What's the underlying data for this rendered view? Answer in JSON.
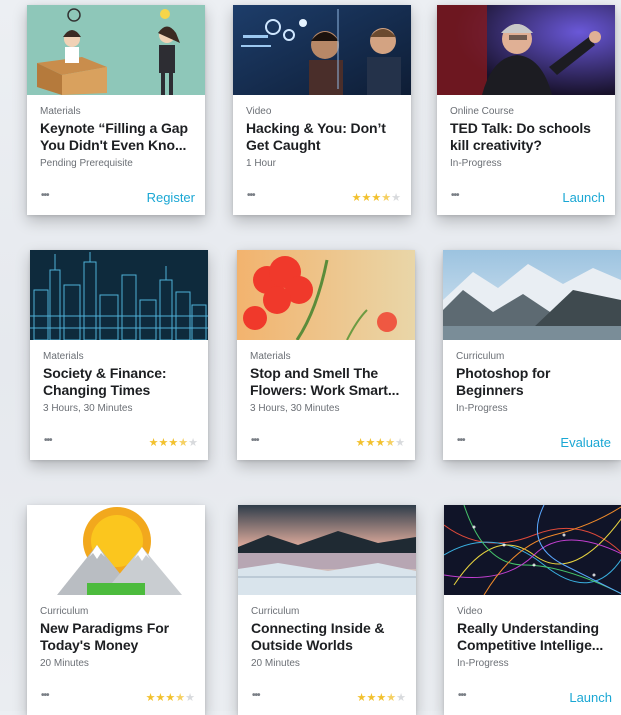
{
  "cards": [
    {
      "type": "Materials",
      "title": "Keynote “Filling a Gap You Didn't Even Kno...",
      "meta": "Pending Prerequisite",
      "action": "Register",
      "rating": null,
      "thumbnail": "cartoon-box-people"
    },
    {
      "type": "Video",
      "title": "Hacking & You: Don’t Get Caught",
      "meta": "1 Hour",
      "action": null,
      "rating": 3.5,
      "thumbnail": "hackers-screen"
    },
    {
      "type": "Online Course",
      "title": "TED Talk: Do schools kill creativity?",
      "meta": "In-Progress",
      "action": "Launch",
      "rating": null,
      "thumbnail": "speaker-stage"
    },
    {
      "type": "Materials",
      "title": "Society & Finance: Changing Times",
      "meta": "3 Hours, 30 Minutes",
      "action": null,
      "rating": 3.5,
      "thumbnail": "city-skyline"
    },
    {
      "type": "Materials",
      "title": "Stop and Smell The Flowers: Work Smart...",
      "meta": "3 Hours, 30 Minutes",
      "action": null,
      "rating": 3.5,
      "thumbnail": "red-flowers"
    },
    {
      "type": "Curriculum",
      "title": "Photoshop for Beginners",
      "meta": "In-Progress",
      "action": "Evaluate",
      "rating": null,
      "thumbnail": "mountain-lake"
    },
    {
      "type": "Curriculum",
      "title": "New Paradigms For Today's Money",
      "meta": "20 Minutes",
      "action": null,
      "rating": 3.5,
      "thumbnail": "sun-mountains"
    },
    {
      "type": "Curriculum",
      "title": "Connecting Inside & Outside Worlds",
      "meta": "20 Minutes",
      "action": null,
      "rating": 3.5,
      "thumbnail": "lake-reflection"
    },
    {
      "type": "Video",
      "title": "Really Understanding Competitive Intellige...",
      "meta": "In-Progress",
      "action": "Launch",
      "rating": null,
      "thumbnail": "neural-network"
    }
  ],
  "more_label": "•••",
  "colors": {
    "accent": "#1aa7d4",
    "star": "#f2c12e",
    "star_off": "#d8dadd"
  },
  "star_glyph": "★"
}
